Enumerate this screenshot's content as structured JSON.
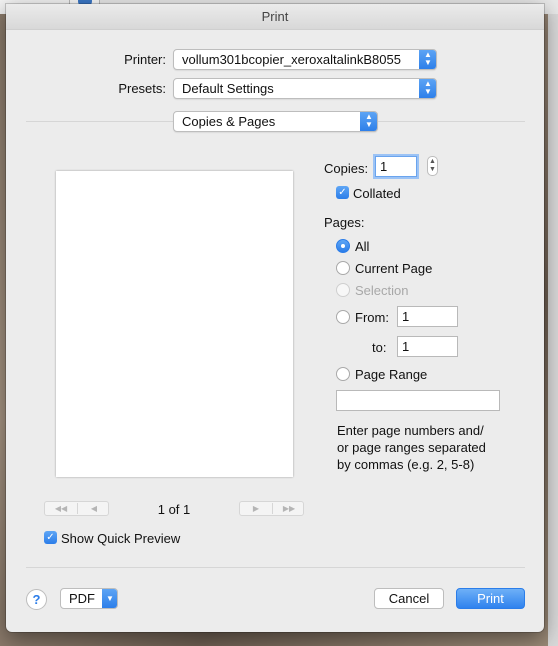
{
  "dialog": {
    "title": "Print"
  },
  "printer": {
    "label": "Printer:",
    "value": "vollum301bcopier_xeroxaltalinkB8055"
  },
  "presets": {
    "label": "Presets:",
    "value": "Default Settings"
  },
  "section": {
    "value": "Copies & Pages"
  },
  "preview": {
    "page_indicator": "1 of 1",
    "first_glyph": "◀◀",
    "prev_glyph": "◀",
    "next_glyph": "▶",
    "last_glyph": "▶▶",
    "show_quick_preview_label": "Show Quick Preview",
    "show_quick_preview_checked": true
  },
  "copies": {
    "label": "Copies:",
    "value": "1",
    "collated_label": "Collated",
    "collated_checked": true
  },
  "pages": {
    "label": "Pages:",
    "options": [
      {
        "label": "All",
        "selected": true,
        "enabled": true
      },
      {
        "label": "Current Page",
        "selected": false,
        "enabled": true
      },
      {
        "label": "Selection",
        "selected": false,
        "enabled": false
      },
      {
        "label": "From:",
        "selected": false,
        "enabled": true
      },
      {
        "label": "Page Range",
        "selected": false,
        "enabled": true
      }
    ],
    "from_value": "1",
    "to_label": "to:",
    "to_value": "1",
    "range_value": "",
    "hint_lines": [
      "Enter page numbers and/",
      "or page ranges separated",
      "by commas (e.g. 2, 5-8)"
    ]
  },
  "footer": {
    "help_glyph": "?",
    "pdf_label": "PDF",
    "cancel_label": "Cancel",
    "print_label": "Print"
  },
  "colors": {
    "accent": "#2b7de9",
    "dialog_bg": "#ececec"
  }
}
